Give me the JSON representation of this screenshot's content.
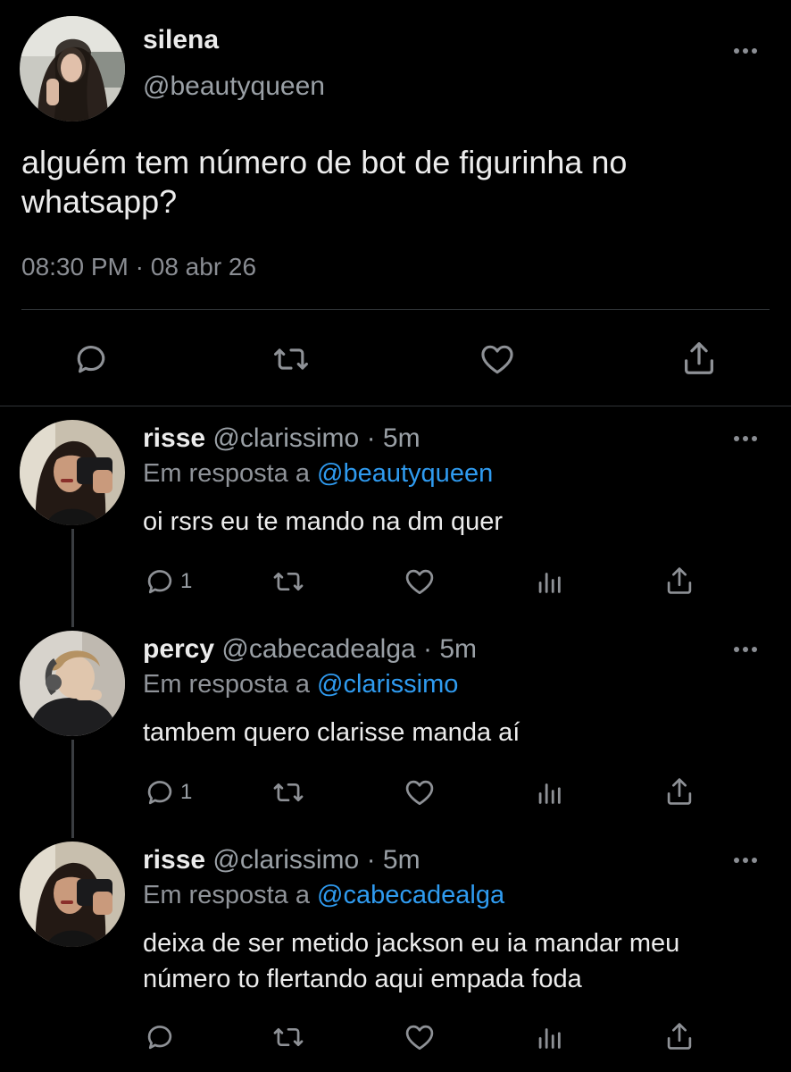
{
  "main_tweet": {
    "avatar": "avatar-silena",
    "name": "silena",
    "handle": "@beautyqueen",
    "text": "alguém tem número de bot de figurinha no whatsapp?",
    "time": "08:30 PM",
    "separator": "·",
    "date": "08 abr 26",
    "actions": [
      "reply-icon",
      "retweet-icon",
      "like-icon",
      "share-icon"
    ]
  },
  "replies": [
    {
      "name": "risse",
      "handle": "@clarissimo",
      "dot": "·",
      "time": "5m",
      "reply_prefix": "Em resposta a",
      "reply_to": "@beautyqueen",
      "text": "oi rsrs eu te mando na dm quer",
      "reply_count": "1"
    },
    {
      "name": "percy",
      "handle": "@cabecadealga",
      "dot": "·",
      "time": "5m",
      "reply_prefix": "Em resposta a",
      "reply_to": "@clarissimo",
      "text": "tambem quero clarisse manda aí",
      "reply_count": "1"
    },
    {
      "name": "risse",
      "handle": "@clarissimo",
      "dot": "·",
      "time": "5m",
      "reply_prefix": "Em resposta a",
      "reply_to": "@cabecadealga",
      "text": "deixa de ser metido jackson eu ia mandar meu número to flertando aqui empada foda",
      "reply_count": ""
    }
  ],
  "colors": {
    "background": "#000000",
    "link": "#2f9bf0",
    "muted": "#8e9196",
    "text": "#ececec"
  }
}
